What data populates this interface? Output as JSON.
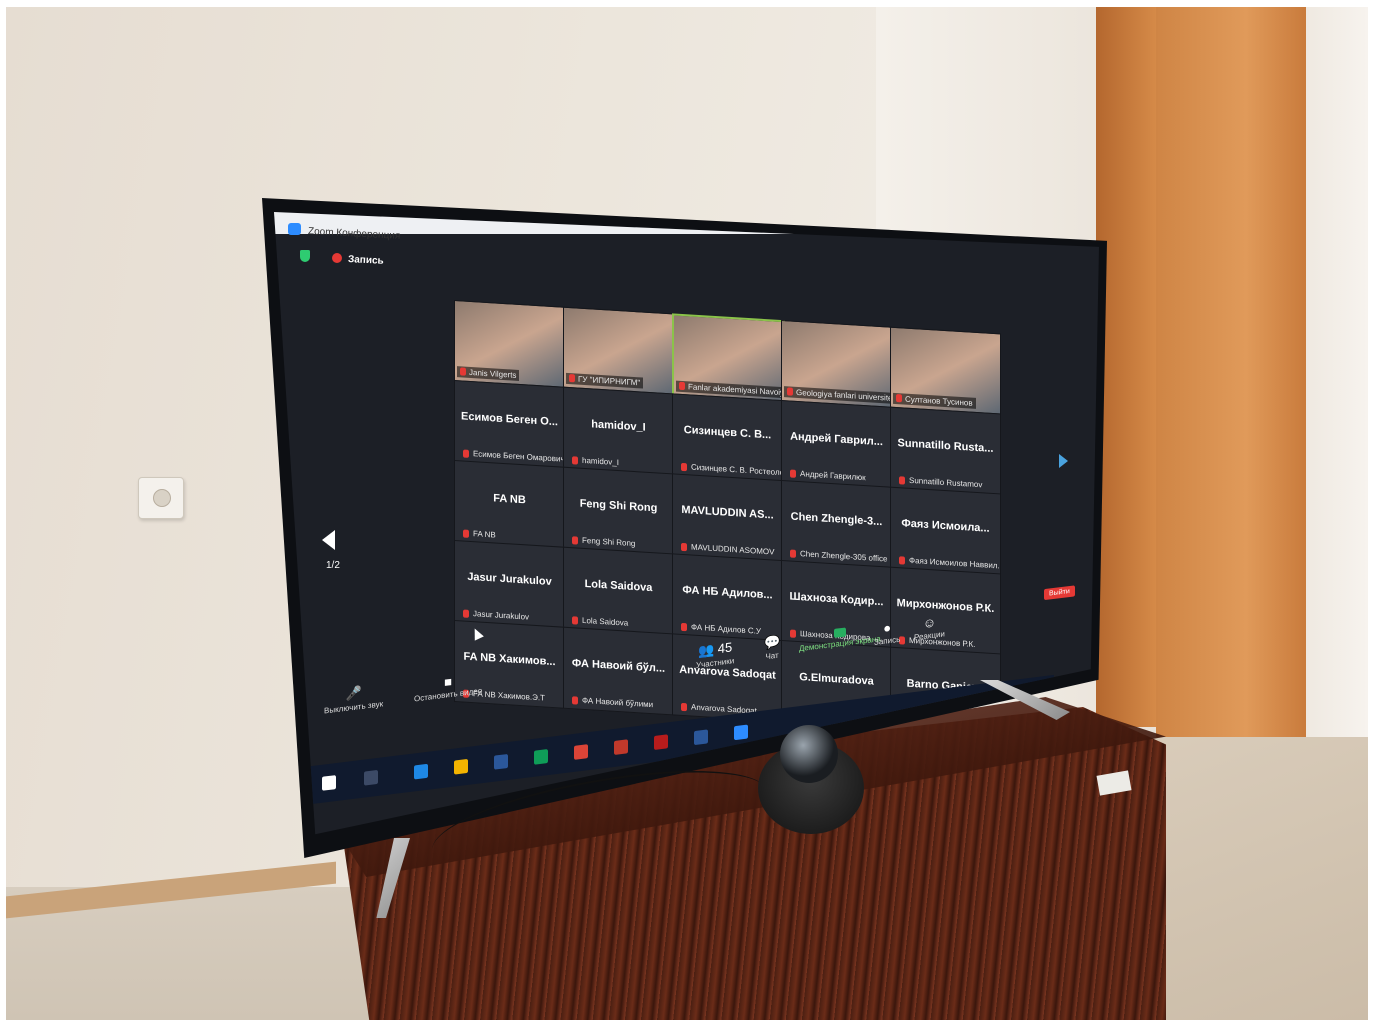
{
  "window": {
    "title": "Zoom Конференция",
    "recording_label": "Запись"
  },
  "gallery": {
    "page_indicator": "1/2",
    "video_tiles": [
      {
        "label": "Janis Vilgerts"
      },
      {
        "label": "ГУ \"ИПИРНИГМ\""
      },
      {
        "label": "Fanlar akademiyasi Navoiy bo..."
      },
      {
        "label": "Geologiya fanlari universiteti"
      },
      {
        "label": "Султанов Тусинов"
      }
    ],
    "name_tiles": [
      {
        "display": "Есимов Беген О...",
        "label": "Есимов Беген Омарович"
      },
      {
        "display": "hamidov_I",
        "label": "hamidov_I"
      },
      {
        "display": "Сизинцев С. В...",
        "label": "Сизинцев С. В. Ростеология"
      },
      {
        "display": "Андрей Гаврил...",
        "label": "Андрей Гаврилюк"
      },
      {
        "display": "Sunnatillo Rusta...",
        "label": "Sunnatillo Rustamov"
      },
      {
        "display": "FA NB",
        "label": "FA NB"
      },
      {
        "display": "Feng Shi Rong",
        "label": "Feng Shi Rong"
      },
      {
        "display": "MAVLUDDIN AS...",
        "label": "MAVLUDDIN ASOMOV"
      },
      {
        "display": "Chen Zhengle-3...",
        "label": "Chen Zhengle-305 office X..."
      },
      {
        "display": "Фаяз Исмоила...",
        "label": "Фаяз Исмоилов Наввил..."
      },
      {
        "display": "Jasur Jurakulov",
        "label": "Jasur Jurakulov"
      },
      {
        "display": "Lola Saidova",
        "label": "Lola Saidova"
      },
      {
        "display": "ФА НБ Адилов...",
        "label": "ФА НБ Адилов С.У"
      },
      {
        "display": "Шахноза Кодир...",
        "label": "Шахноза Кодирова"
      },
      {
        "display": "Мирхонжонов Р.К.",
        "label": "Мирхонжонов Р.К."
      },
      {
        "display": "FA NB Хакимов...",
        "label": "FA NB Хакимов.Э.Т"
      },
      {
        "display": "ФА Навоий бўл...",
        "label": "ФА Навоий бўлими"
      },
      {
        "display": "Anvarova Sadoqat",
        "label": "Anvarova Sadoqat"
      },
      {
        "display": "G.Elmuradova",
        "label": "G.Elmuradova"
      },
      {
        "display": "Barno Ganieva",
        "label": "Barno Ganieva"
      }
    ]
  },
  "toolbar": {
    "mute_label": "Выключить звук",
    "video_label": "Остановить видео",
    "participants_label": "Участники",
    "participants_count": "45",
    "chat_label": "Чат",
    "share_label": "Демонстрация экрана",
    "record_label": "Запись",
    "reactions_label": "Реакции",
    "leave_label": "Выйти"
  },
  "colors": {
    "zoom_blue": "#2d8cff",
    "share_green": "#27ae60",
    "recording_red": "#e53935",
    "active_speaker": "#8bc34a"
  }
}
